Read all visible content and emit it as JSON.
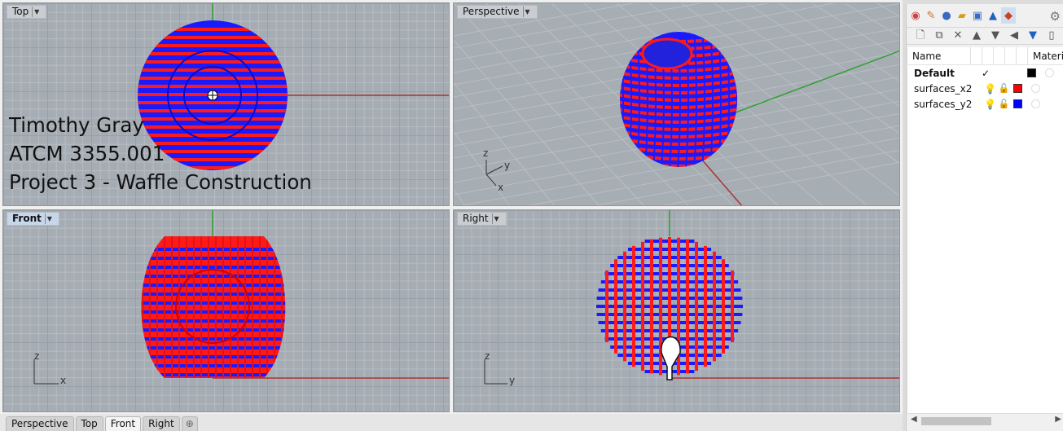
{
  "viewports": {
    "top": {
      "label": "Top"
    },
    "perspective": {
      "label": "Perspective"
    },
    "front": {
      "label": "Front"
    },
    "right": {
      "label": "Right"
    }
  },
  "overlay": {
    "line1": "Timothy Gray",
    "line2": "ATCM 3355.001",
    "line3": "Project 3 - Waffle Construction"
  },
  "axes": {
    "x": "x",
    "y": "y",
    "z": "z"
  },
  "tabs": [
    "Perspective",
    "Top",
    "Front",
    "Right"
  ],
  "active_tab": "Front",
  "panel": {
    "col_name": "Name",
    "col_material": "Materi",
    "layers": [
      {
        "name": "Default",
        "current": true,
        "check": "✓",
        "color": "#000000"
      },
      {
        "name": "surfaces_x2",
        "current": false,
        "check": "",
        "color": "#ff0000"
      },
      {
        "name": "surfaces_y2",
        "current": false,
        "check": "",
        "color": "#0000ff"
      }
    ]
  },
  "colors": {
    "red": "#ff1a1a",
    "blue": "#1a1aff",
    "x_axis": "#b03030",
    "y_axis": "#30a030"
  }
}
